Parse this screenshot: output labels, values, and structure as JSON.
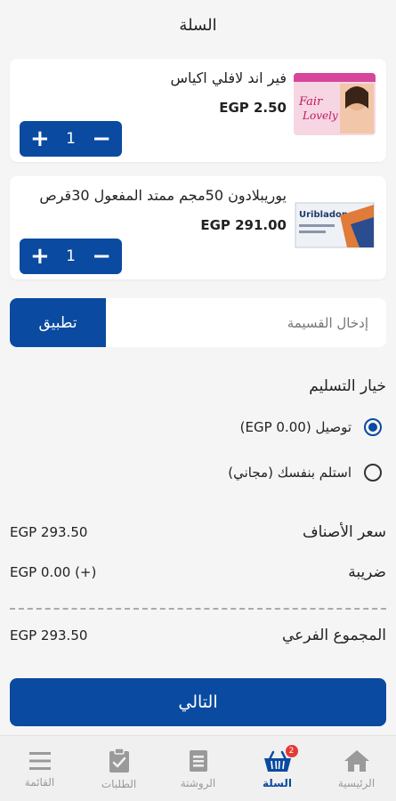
{
  "header": {
    "title": "السلة"
  },
  "cart_items": [
    {
      "name": "فير اند لافلي اكياس",
      "price": "EGP 2.50",
      "quantity": "1",
      "image_icon": "fair-lovely-product-image"
    },
    {
      "name": "يوريبلادون 50مجم ممتد المفعول 30قرص",
      "price": "EGP 291.00",
      "quantity": "1",
      "image_icon": "uribladon-product-image"
    }
  ],
  "coupon": {
    "placeholder": "إدخال القسيمة",
    "apply_label": "تطبيق"
  },
  "delivery": {
    "title": "خيار التسليم",
    "options": [
      {
        "label": "توصيل (EGP 0.00)",
        "selected": true
      },
      {
        "label": "استلم بنفسك (مجاني)",
        "selected": false
      }
    ]
  },
  "summary": {
    "items_price_label": "سعر الأصناف",
    "items_price_value": "EGP 293.50",
    "tax_label": "ضريبة",
    "tax_value": "EGP 0.00 (+)",
    "subtotal_label": "المجموع الفرعي",
    "subtotal_value": "EGP 293.50"
  },
  "next_label": "التالي",
  "nav": {
    "items": [
      {
        "label": "الرئيسية",
        "icon": "home-icon",
        "active": false
      },
      {
        "label": "السلة",
        "icon": "basket-icon",
        "active": true,
        "badge": "2"
      },
      {
        "label": "الروشتة",
        "icon": "prescription-icon",
        "active": false
      },
      {
        "label": "الطلبات",
        "icon": "orders-icon",
        "active": false
      },
      {
        "label": "القائمة",
        "icon": "menu-icon",
        "active": false
      }
    ]
  },
  "colors": {
    "primary": "#0a4aa0",
    "background": "#f5f5f5",
    "badge": "#e53935"
  }
}
